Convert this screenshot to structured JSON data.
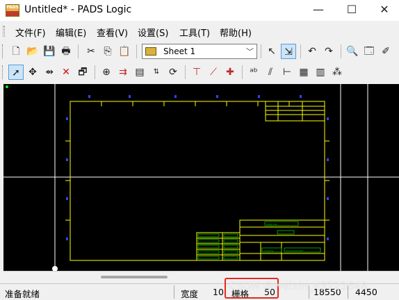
{
  "window": {
    "title": "Untitled* - PADS Logic",
    "app_icon_text": "PADS",
    "minimize_glyph": "—",
    "maximize_glyph": "☐",
    "close_glyph": "✕"
  },
  "menu": {
    "items": [
      "文件(F)",
      "编辑(E)",
      "查看(V)",
      "设置(S)",
      "工具(T)",
      "帮助(H)"
    ]
  },
  "toolbar1": {
    "sheet_label": "Sheet 1",
    "icons": [
      "new-icon",
      "open-icon",
      "save-icon",
      "print-icon",
      "cut-icon",
      "copy-icon",
      "paste-icon",
      "select-arrow-icon",
      "select-filter-icon",
      "undo-icon",
      "redo-icon",
      "zoom-icon",
      "properties-icon",
      "pin-icon"
    ]
  },
  "toolbar2": {
    "icons": [
      "select-icon",
      "move-icon",
      "add-connection-icon",
      "delete-icon",
      "browse-icon",
      "add-part-icon",
      "add-bus-icon",
      "add-field-icon",
      "swap-pin-icon",
      "rotate-icon",
      "split-bus-icon",
      "add-wire-icon",
      "add-net-label-icon",
      "text-icon",
      "bus-entry-icon",
      "reference-icon",
      "gates-icon",
      "net-icon"
    ]
  },
  "canvas": {
    "background": "#000000",
    "frame_color": "#ffff00",
    "grid_color": "#ffffff",
    "marker_color": "#0000ff",
    "text_color": "#00c800",
    "title_block_text_1": "Sheet Title",
    "title_block_text_2": "Drawing Number",
    "title_block_text_3": "Company"
  },
  "status": {
    "ready": "准备就绪",
    "width_label": "宽度",
    "width_value": "10",
    "grid_label": "栅格",
    "grid_value": "50",
    "x_value": "18550",
    "y_value": "4450"
  },
  "watermark": "CSDN @weixin_45723648"
}
